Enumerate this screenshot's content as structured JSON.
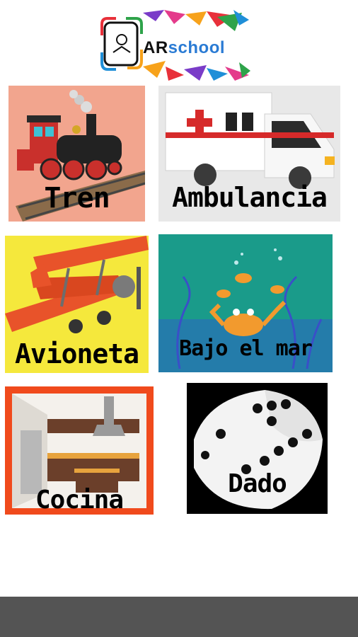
{
  "app": {
    "logo_ar": "AR",
    "logo_school": "school"
  },
  "tiles": [
    {
      "label": "Tren"
    },
    {
      "label": "Ambulancia"
    },
    {
      "label": "Avioneta"
    },
    {
      "label": "Bajo el mar"
    },
    {
      "label": "Cocina"
    },
    {
      "label": "Dado"
    }
  ],
  "colors": {
    "tren_bg": "#f2a58e",
    "ambulancia_bg": "#e8e8e8",
    "avioneta_bg": "#f5e83c",
    "bajo_bg": "#1a9b8a",
    "cocina_bg": "#f04a1c",
    "dado_bg": "#000000"
  }
}
